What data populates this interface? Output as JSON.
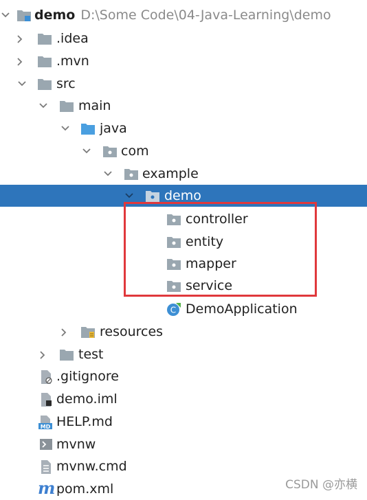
{
  "project": {
    "name": "demo",
    "path": "D:\\Some Code\\04-Java-Learning\\demo"
  },
  "tree": {
    "idea": ".idea",
    "mvn": ".mvn",
    "src": "src",
    "main": "main",
    "java": "java",
    "com": "com",
    "example": "example",
    "demo": "demo",
    "controller": "controller",
    "entity": "entity",
    "mapper": "mapper",
    "service": "service",
    "demo_application": "DemoApplication",
    "resources": "resources",
    "test": "test",
    "gitignore": ".gitignore",
    "demo_iml": "demo.iml",
    "help_md": "HELP.md",
    "mvnw": "mvnw",
    "mvnw_cmd": "mvnw.cmd",
    "pom_xml": "pom.xml"
  },
  "icon_glyphs": {
    "md": "MD",
    "maven": "m"
  },
  "watermark": "CSDN @亦横",
  "colors": {
    "selection": "#2e75bb",
    "folder": "#9aa7b0",
    "source_folder": "#4a9fe0",
    "highlight_box": "#e0383c"
  }
}
